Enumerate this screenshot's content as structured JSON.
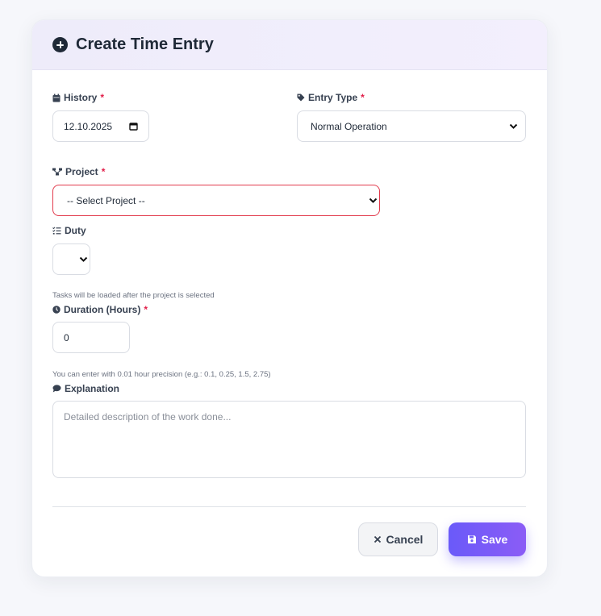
{
  "header": {
    "title": "Create Time Entry",
    "icon": "plus-circle-icon"
  },
  "form": {
    "history": {
      "label": "History",
      "required_mark": "*",
      "value": "12.10.2025",
      "icon": "calendar-icon"
    },
    "entry_type": {
      "label": "Entry Type",
      "required_mark": "*",
      "value": "Normal Operation",
      "icon": "tag-icon"
    },
    "project": {
      "label": "Project",
      "required_mark": "*",
      "value": "-- Select Project --",
      "icon": "sitemap-icon"
    },
    "duty": {
      "label": "Duty",
      "value": "",
      "help": "Tasks will be loaded after the project is selected",
      "icon": "list-check-icon"
    },
    "duration": {
      "label": "Duration (Hours)",
      "required_mark": "*",
      "value": "0",
      "help": "You can enter with 0.01 hour precision (e.g.: 0.1, 0.25, 1.5, 2.75)",
      "icon": "clock-icon"
    },
    "explanation": {
      "label": "Explanation",
      "placeholder": "Detailed description of the work done...",
      "icon": "comment-icon"
    }
  },
  "actions": {
    "cancel_label": "Cancel",
    "save_label": "Save"
  },
  "colors": {
    "accent": "#6a5af9",
    "accent_end": "#8b5cf6",
    "required": "#e11d48",
    "invalid_border": "#e23b4d",
    "header_bg": "#eeecfa"
  }
}
